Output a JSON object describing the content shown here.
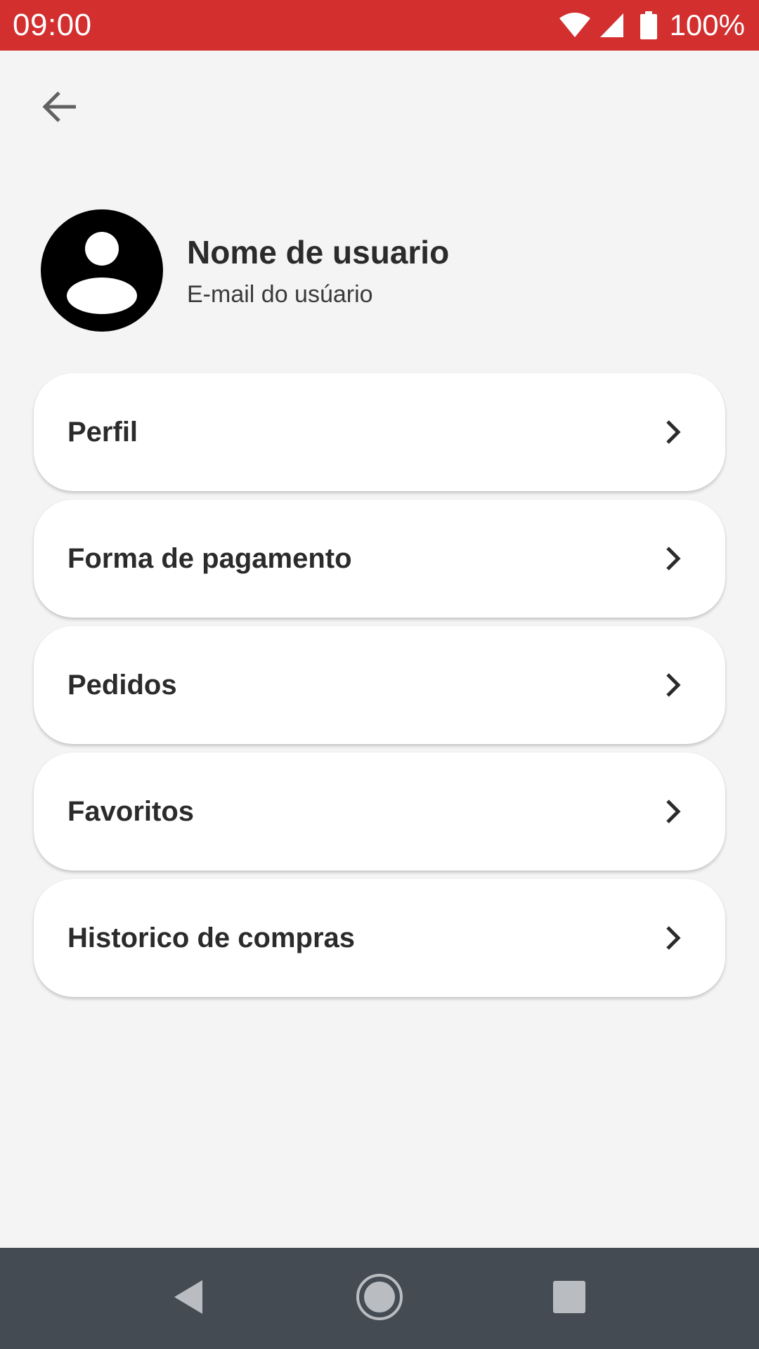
{
  "status_bar": {
    "time": "09:00",
    "battery_text": "100%",
    "background_color": "#d32f2f",
    "icons": [
      "wifi-icon",
      "signal-icon",
      "battery-icon"
    ]
  },
  "header": {
    "back_icon": "arrow-left-icon"
  },
  "profile": {
    "name": "Nome de usuario",
    "email": "E-mail do usúario",
    "avatar_icon": "account-circle-icon"
  },
  "menu": {
    "items": [
      {
        "label": "Perfil"
      },
      {
        "label": "Forma de pagamento"
      },
      {
        "label": "Pedidos"
      },
      {
        "label": "Favoritos"
      },
      {
        "label": "Historico de compras"
      }
    ],
    "item_icon": "chevron-right-icon"
  },
  "nav_bar": {
    "background_color": "#444b52",
    "buttons": [
      "nav-back-icon",
      "nav-home-icon",
      "nav-recents-icon"
    ]
  }
}
